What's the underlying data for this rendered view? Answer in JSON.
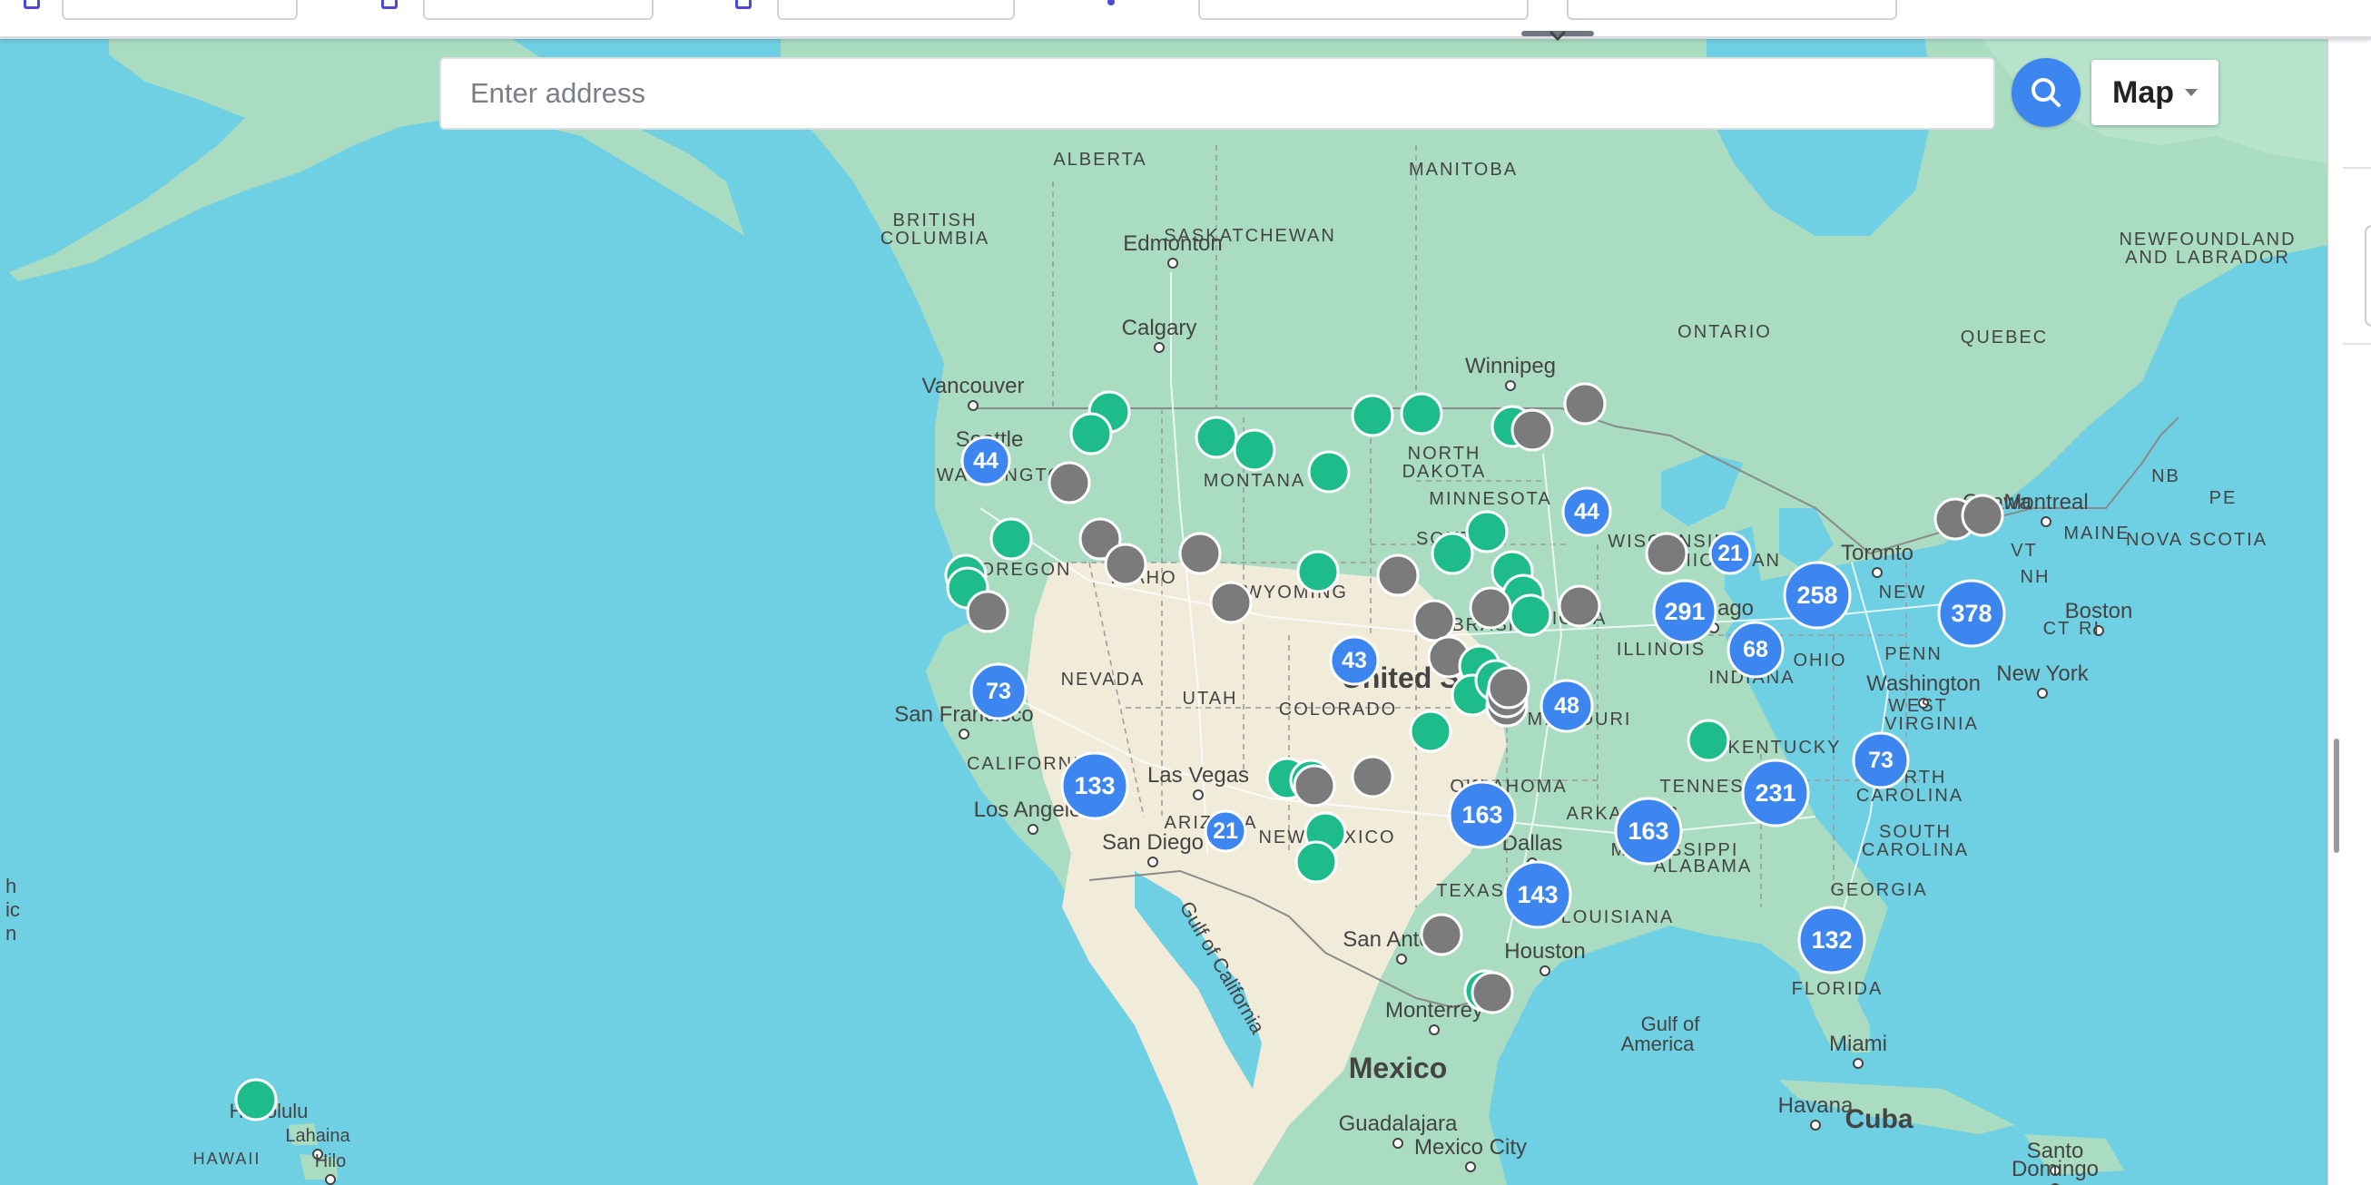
{
  "search": {
    "placeholder": "Enter address"
  },
  "map_type": {
    "selected": "Map"
  },
  "colors": {
    "cluster": "#3d86f0",
    "active": "#1ebc8a",
    "inactive": "#7b7b7b",
    "water": "#6fd0e3",
    "land": "#a9dcc1",
    "desert": "#f1ebda"
  },
  "labels": [
    {
      "text": "ALBERTA",
      "kind": "region"
    },
    {
      "text": "MANITOBA",
      "kind": "region"
    },
    {
      "text": "BRITISH",
      "kind": "region"
    },
    {
      "text": "COLUMBIA",
      "kind": "region"
    },
    {
      "text": "SASKATCHEWAN",
      "kind": "region"
    },
    {
      "text": "Edmonton",
      "kind": "city"
    },
    {
      "text": "NEWFOUNDLAND",
      "kind": "region"
    },
    {
      "text": "AND LABRADOR",
      "kind": "region"
    },
    {
      "text": "Calgary",
      "kind": "city"
    },
    {
      "text": "ONTARIO",
      "kind": "region"
    },
    {
      "text": "QUEBEC",
      "kind": "region"
    },
    {
      "text": "Winnipeg",
      "kind": "city"
    },
    {
      "text": "Vancouver",
      "kind": "city"
    },
    {
      "text": "Seattle",
      "kind": "city"
    },
    {
      "text": "NORTH",
      "kind": "region"
    },
    {
      "text": "DAKOTA",
      "kind": "region"
    },
    {
      "text": "MONTANA",
      "kind": "region"
    },
    {
      "text": "WASHINGTON",
      "kind": "region"
    },
    {
      "text": "MINNESOTA",
      "kind": "region"
    },
    {
      "text": "Ottawa",
      "kind": "city"
    },
    {
      "text": "Montreal",
      "kind": "city"
    },
    {
      "text": "PE",
      "kind": "region"
    },
    {
      "text": "NB",
      "kind": "region"
    },
    {
      "text": "MAINE",
      "kind": "region"
    },
    {
      "text": "NOVA SCOTIA",
      "kind": "region"
    },
    {
      "text": "OREGON",
      "kind": "region"
    },
    {
      "text": "IDAHO",
      "kind": "region"
    },
    {
      "text": "SOUTH",
      "kind": "region"
    },
    {
      "text": "WYOMING",
      "kind": "region"
    },
    {
      "text": "WISCONSIN",
      "kind": "region"
    },
    {
      "text": "MICHIGAN",
      "kind": "region"
    },
    {
      "text": "Toronto",
      "kind": "city"
    },
    {
      "text": "VT",
      "kind": "region"
    },
    {
      "text": "NH",
      "kind": "region"
    },
    {
      "text": "NEW",
      "kind": "region"
    },
    {
      "text": "NEBRASKA",
      "kind": "region"
    },
    {
      "text": "Chicago",
      "kind": "city"
    },
    {
      "text": "Boston",
      "kind": "city"
    },
    {
      "text": "RI",
      "kind": "region"
    },
    {
      "text": "CT",
      "kind": "region"
    },
    {
      "text": "IOWA",
      "kind": "region"
    },
    {
      "text": "ILLINOIS",
      "kind": "region"
    },
    {
      "text": "PENN",
      "kind": "region"
    },
    {
      "text": "NEVADA",
      "kind": "region"
    },
    {
      "text": "UTAH",
      "kind": "region"
    },
    {
      "text": "United States",
      "kind": "country"
    },
    {
      "text": "INDIANA",
      "kind": "region"
    },
    {
      "text": "OHIO",
      "kind": "region"
    },
    {
      "text": "Washington",
      "kind": "city"
    },
    {
      "text": "New York",
      "kind": "city"
    },
    {
      "text": "San Francisco",
      "kind": "city"
    },
    {
      "text": "COLORADO",
      "kind": "region"
    },
    {
      "text": "MISSOURI",
      "kind": "region"
    },
    {
      "text": "WEST",
      "kind": "region"
    },
    {
      "text": "VIRGINIA",
      "kind": "region"
    },
    {
      "text": "KENTUCKY",
      "kind": "region"
    },
    {
      "text": "CALIFORNIA",
      "kind": "region"
    },
    {
      "text": "Las Vegas",
      "kind": "city"
    },
    {
      "text": "OKLAHOMA",
      "kind": "region"
    },
    {
      "text": "TENNESSEE",
      "kind": "region"
    },
    {
      "text": "NORTH",
      "kind": "region"
    },
    {
      "text": "CAROLINA",
      "kind": "region"
    },
    {
      "text": "Los Angeles",
      "kind": "city"
    },
    {
      "text": "ARIZONA",
      "kind": "region"
    },
    {
      "text": "ARKANSAS",
      "kind": "region"
    },
    {
      "text": "NEW MEXICO",
      "kind": "region"
    },
    {
      "text": "Dallas",
      "kind": "city"
    },
    {
      "text": "SOUTH",
      "kind": "region"
    },
    {
      "text": "CAROLINA",
      "kind": "region"
    },
    {
      "text": "San Diego",
      "kind": "city"
    },
    {
      "text": "MISSISSIPPI",
      "kind": "region"
    },
    {
      "text": "ALABAMA",
      "kind": "region"
    },
    {
      "text": "GEORGIA",
      "kind": "region"
    },
    {
      "text": "TEXAS",
      "kind": "region"
    },
    {
      "text": "LOUISIANA",
      "kind": "region"
    },
    {
      "text": "San Antonio",
      "kind": "city"
    },
    {
      "text": "Houston",
      "kind": "city"
    },
    {
      "text": "FLORIDA",
      "kind": "region"
    },
    {
      "text": "Gulf of California",
      "kind": "water"
    },
    {
      "text": "Monterrey",
      "kind": "city"
    },
    {
      "text": "Gulf of",
      "kind": "water"
    },
    {
      "text": "America",
      "kind": "water"
    },
    {
      "text": "Miami",
      "kind": "city"
    },
    {
      "text": "Mexico",
      "kind": "country"
    },
    {
      "text": "Havana",
      "kind": "city"
    },
    {
      "text": "Cuba",
      "kind": "country"
    },
    {
      "text": "Guadalajara",
      "kind": "city"
    },
    {
      "text": "Mexico City",
      "kind": "city"
    },
    {
      "text": "Santo",
      "kind": "city"
    },
    {
      "text": "Domingo",
      "kind": "city"
    },
    {
      "text": "Honolulu",
      "kind": "city"
    },
    {
      "text": "Lahaina",
      "kind": "city"
    },
    {
      "text": "HAWAII",
      "kind": "region"
    },
    {
      "text": "Hilo",
      "kind": "city"
    },
    {
      "text": "h",
      "kind": "water"
    },
    {
      "text": "ic",
      "kind": "water"
    },
    {
      "text": "n",
      "kind": "water"
    }
  ],
  "clusters": [
    {
      "count": "44"
    },
    {
      "count": "44"
    },
    {
      "count": "21"
    },
    {
      "count": "291"
    },
    {
      "count": "258"
    },
    {
      "count": "378"
    },
    {
      "count": "68"
    },
    {
      "count": "43"
    },
    {
      "count": "73"
    },
    {
      "count": "48"
    },
    {
      "count": "133"
    },
    {
      "count": "163"
    },
    {
      "count": "73"
    },
    {
      "count": "231"
    },
    {
      "count": "163"
    },
    {
      "count": "21"
    },
    {
      "count": "143"
    },
    {
      "count": "132"
    }
  ]
}
